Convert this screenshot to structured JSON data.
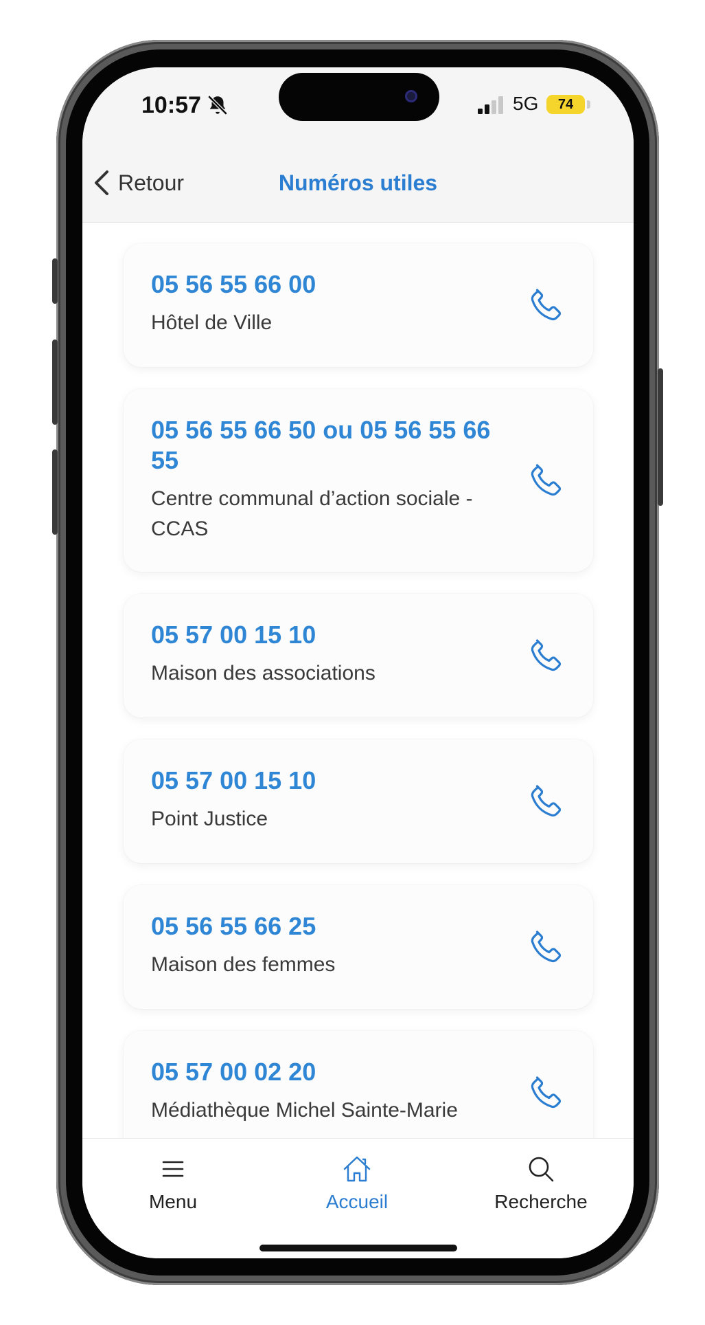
{
  "status_bar": {
    "time": "10:57",
    "network": "5G",
    "battery": "74"
  },
  "header": {
    "back_label": "Retour",
    "title": "Numéros utiles"
  },
  "contacts": [
    {
      "number": "05 56 55 66 00",
      "name": "Hôtel de Ville"
    },
    {
      "number": "05 56 55 66 50 ou 05 56 55 66 55",
      "name": "Centre communal d’action sociale - CCAS"
    },
    {
      "number": "05 57 00 15 10",
      "name": "Maison des associations"
    },
    {
      "number": "05 57 00 15 10",
      "name": "Point Justice"
    },
    {
      "number": "05 56 55 66 25",
      "name": "Maison des femmes"
    },
    {
      "number": "05 57 00 02 20",
      "name": "Médiathèque Michel Sainte-Marie"
    }
  ],
  "tabs": {
    "menu": "Menu",
    "home": "Accueil",
    "search": "Recherche"
  },
  "colors": {
    "accent": "#2a7dd0",
    "number": "#2f86d4",
    "battery": "#f5d52b"
  }
}
